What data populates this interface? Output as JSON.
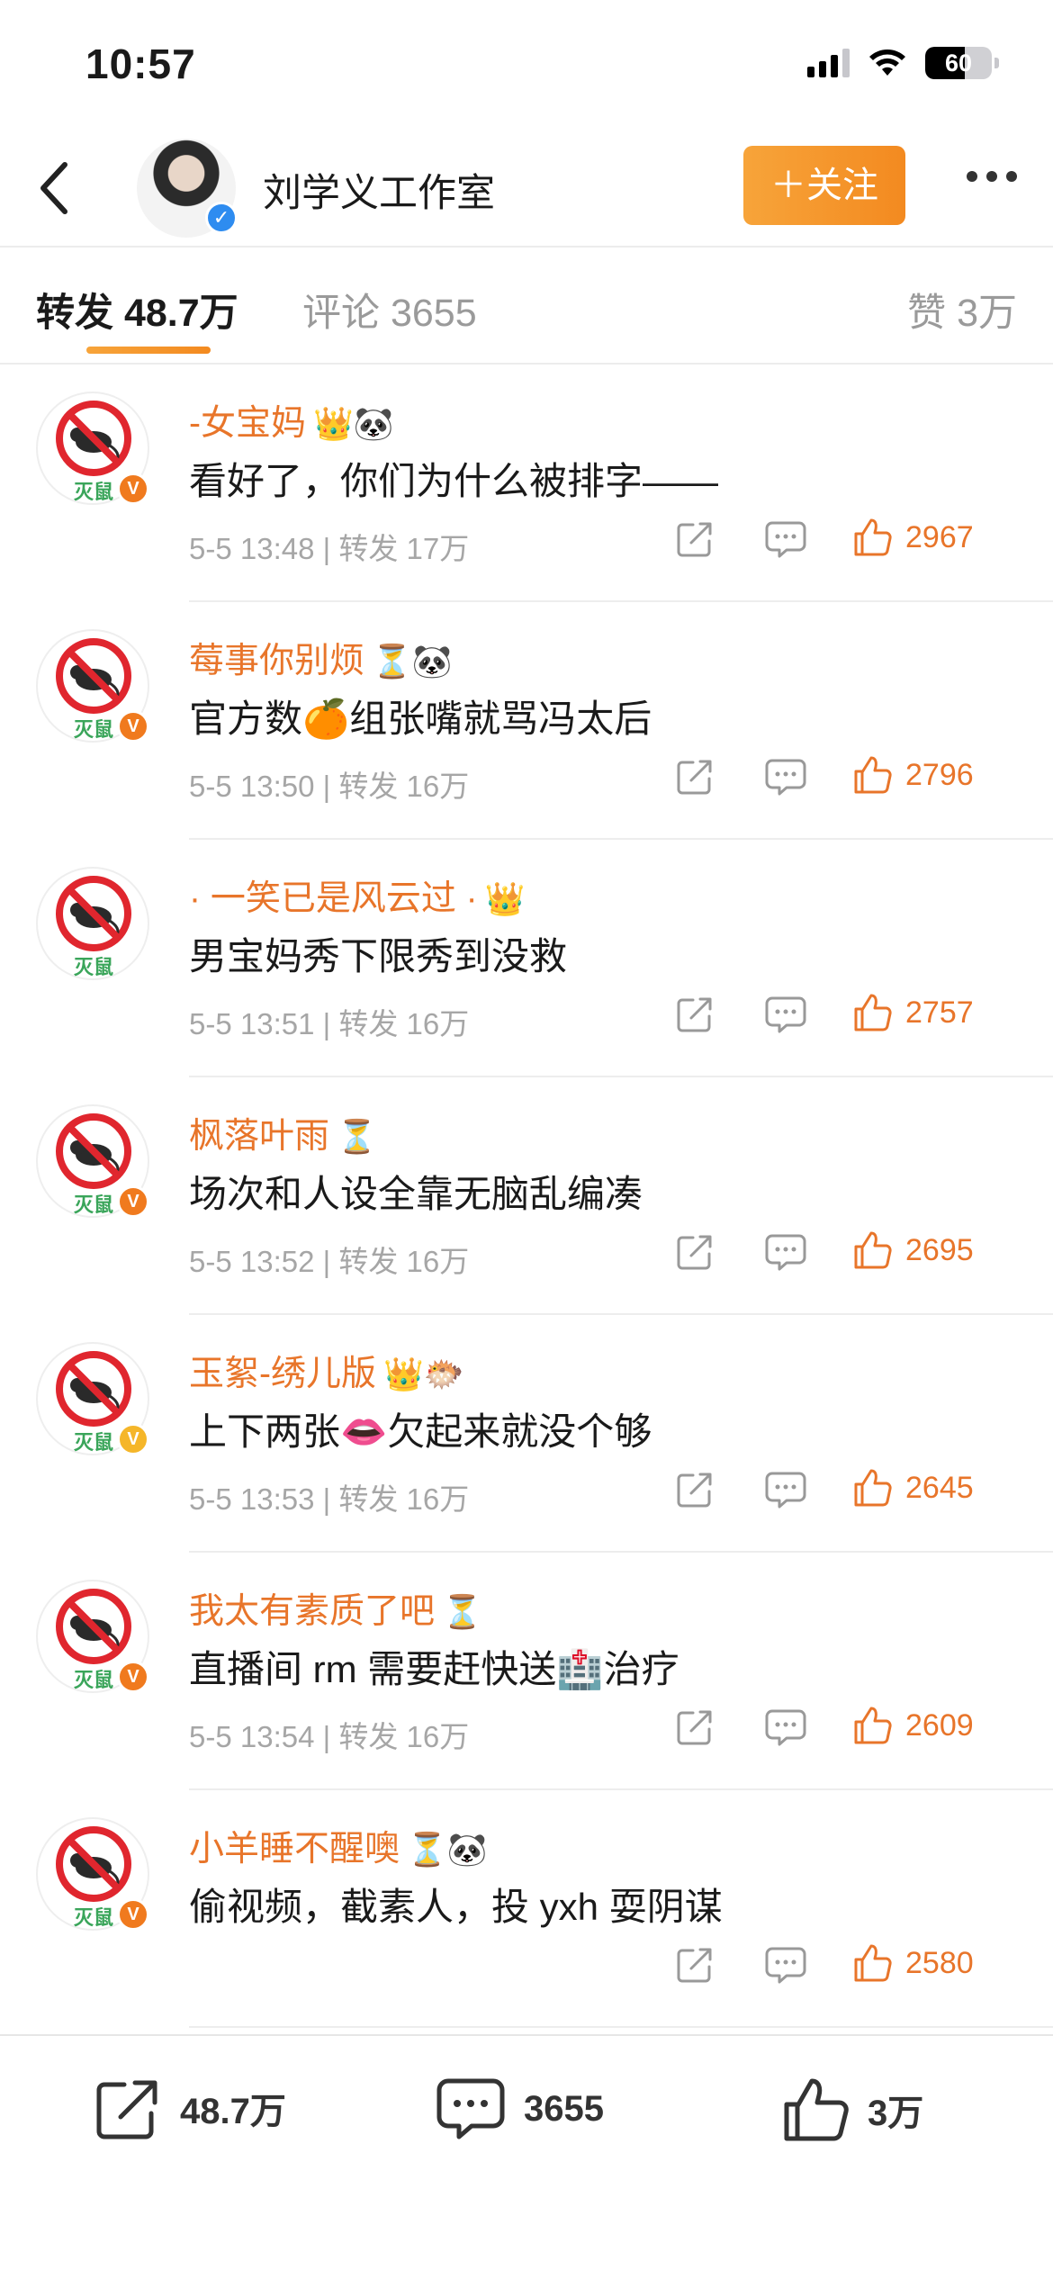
{
  "status_bar": {
    "time": "10:57",
    "battery": "60",
    "battery_level": 0.6
  },
  "header": {
    "title": "刘学义工作室",
    "follow_label": "＋关注"
  },
  "tabs": {
    "repost": "转发 48.7万",
    "comment": "评论 3655",
    "like": "赞 3万"
  },
  "comments": [
    {
      "username": "-女宝妈",
      "badges": "👑🐼",
      "verify": "orange",
      "text": "看好了，你们为什么被排字——",
      "time": "5-5 13:48",
      "repost": "转发 17万",
      "likes": "2967"
    },
    {
      "username": "莓事你别烦",
      "badges": "⏳🐼",
      "verify": "orange",
      "text": "官方数🍊组张嘴就骂冯太后",
      "time": "5-5 13:50",
      "repost": "转发 16万",
      "likes": "2796"
    },
    {
      "username": "· 一笑已是风云过 ·",
      "badges": "👑",
      "verify": "none",
      "text": "男宝妈秀下限秀到没救",
      "time": "5-5 13:51",
      "repost": "转发 16万",
      "likes": "2757"
    },
    {
      "username": "枫落叶雨",
      "badges": "⏳",
      "verify": "orange",
      "text": "场次和人设全靠无脑乱编凑",
      "time": "5-5 13:52",
      "repost": "转发 16万",
      "likes": "2695"
    },
    {
      "username": "玉絮-绣儿版",
      "badges": "👑🐡",
      "verify": "gold",
      "text": "上下两张👄欠起来就没个够",
      "time": "5-5 13:53",
      "repost": "转发 16万",
      "likes": "2645"
    },
    {
      "username": "我太有素质了吧",
      "badges": "⏳",
      "verify": "orange",
      "text": "直播间 rm 需要赶快送🏥治疗",
      "time": "5-5 13:54",
      "repost": "转发 16万",
      "likes": "2609"
    },
    {
      "username": "小羊睡不醒噢",
      "badges": "⏳🐼",
      "verify": "orange",
      "text": "偷视频，截素人，投 yxh 耍阴谋",
      "time": "",
      "repost": "",
      "likes": "2580"
    }
  ],
  "avatar_label": "灭鼠",
  "bottom_bar": {
    "repost": "48.7万",
    "comment": "3655",
    "like": "3万"
  },
  "colors": {
    "accent": "#f38a20",
    "username": "#e8752a",
    "verify_blue": "#2e8cf0"
  }
}
